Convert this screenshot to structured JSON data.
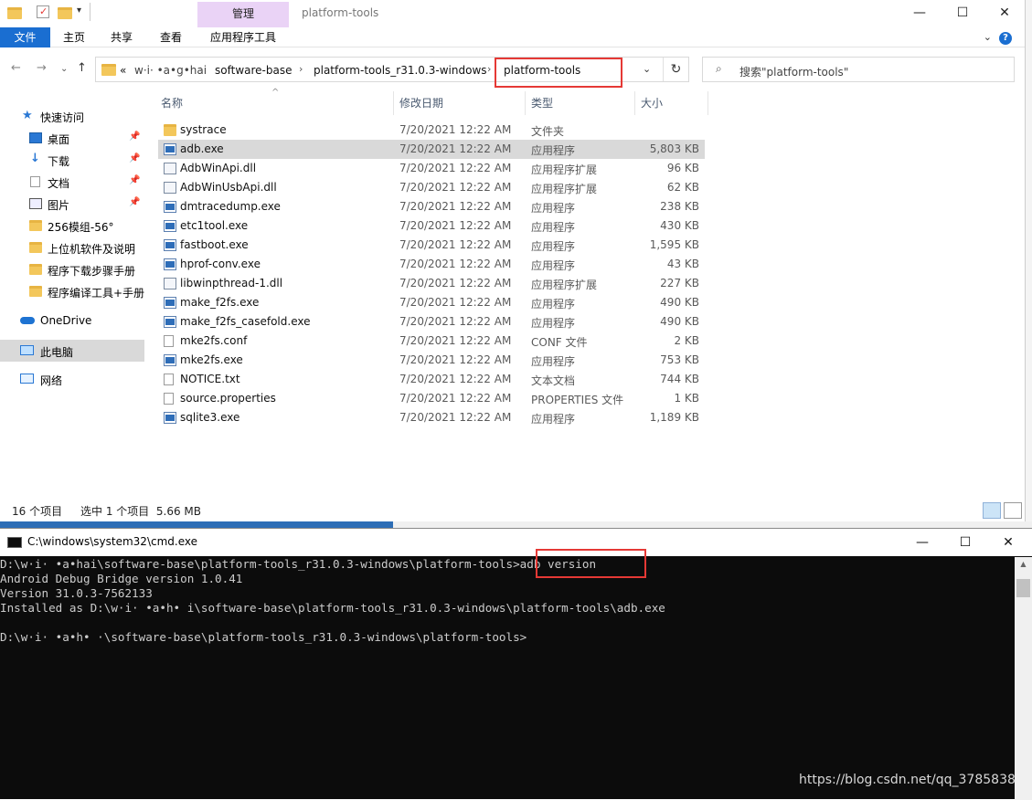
{
  "explorer": {
    "title": "platform-tools",
    "context_tab": "管理",
    "ribbon_tabs": [
      "文件",
      "主页",
      "共享",
      "查看",
      "应用程序工具"
    ],
    "window_buttons": {
      "minimize": "—",
      "maximize": "☐",
      "close": "✕"
    },
    "address_crumbs": [
      "«",
      "w·i· •a•g•hai",
      "software-base",
      "platform-tools_r31.0.3-windows",
      "platform-tools"
    ],
    "search_placeholder": "搜索\"platform-tools\"",
    "nav_pane": [
      {
        "label": "快速访问",
        "icon": "star-icon",
        "pinned": false
      },
      {
        "label": "桌面",
        "icon": "desktop-icon",
        "pinned": true
      },
      {
        "label": "下载",
        "icon": "download-icon",
        "pinned": true
      },
      {
        "label": "文档",
        "icon": "document-icon",
        "pinned": true
      },
      {
        "label": "图片",
        "icon": "picture-icon",
        "pinned": true
      },
      {
        "label": "256模组-56°",
        "icon": "folder-icon",
        "pinned": false
      },
      {
        "label": "上位机软件及说明",
        "icon": "folder-icon",
        "pinned": false
      },
      {
        "label": "程序下载步骤手册",
        "icon": "folder-icon",
        "pinned": false
      },
      {
        "label": "程序编译工具+手册",
        "icon": "folder-icon",
        "pinned": false
      },
      {
        "label": "OneDrive",
        "icon": "cloud-icon",
        "pinned": false
      },
      {
        "label": "此电脑",
        "icon": "computer-icon",
        "pinned": false
      },
      {
        "label": "网络",
        "icon": "network-icon",
        "pinned": false
      }
    ],
    "columns": {
      "name": "名称",
      "date": "修改日期",
      "type": "类型",
      "size": "大小"
    },
    "files": [
      {
        "name": "systrace",
        "date": "7/20/2021 12:22 AM",
        "type": "文件夹",
        "size": "",
        "kind": "folder"
      },
      {
        "name": "adb.exe",
        "date": "7/20/2021 12:22 AM",
        "type": "应用程序",
        "size": "5,803 KB",
        "kind": "exe"
      },
      {
        "name": "AdbWinApi.dll",
        "date": "7/20/2021 12:22 AM",
        "type": "应用程序扩展",
        "size": "96 KB",
        "kind": "dll"
      },
      {
        "name": "AdbWinUsbApi.dll",
        "date": "7/20/2021 12:22 AM",
        "type": "应用程序扩展",
        "size": "62 KB",
        "kind": "dll"
      },
      {
        "name": "dmtracedump.exe",
        "date": "7/20/2021 12:22 AM",
        "type": "应用程序",
        "size": "238 KB",
        "kind": "exe"
      },
      {
        "name": "etc1tool.exe",
        "date": "7/20/2021 12:22 AM",
        "type": "应用程序",
        "size": "430 KB",
        "kind": "exe"
      },
      {
        "name": "fastboot.exe",
        "date": "7/20/2021 12:22 AM",
        "type": "应用程序",
        "size": "1,595 KB",
        "kind": "exe"
      },
      {
        "name": "hprof-conv.exe",
        "date": "7/20/2021 12:22 AM",
        "type": "应用程序",
        "size": "43 KB",
        "kind": "exe"
      },
      {
        "name": "libwinpthread-1.dll",
        "date": "7/20/2021 12:22 AM",
        "type": "应用程序扩展",
        "size": "227 KB",
        "kind": "dll"
      },
      {
        "name": "make_f2fs.exe",
        "date": "7/20/2021 12:22 AM",
        "type": "应用程序",
        "size": "490 KB",
        "kind": "exe"
      },
      {
        "name": "make_f2fs_casefold.exe",
        "date": "7/20/2021 12:22 AM",
        "type": "应用程序",
        "size": "490 KB",
        "kind": "exe"
      },
      {
        "name": "mke2fs.conf",
        "date": "7/20/2021 12:22 AM",
        "type": "CONF 文件",
        "size": "2 KB",
        "kind": "doc"
      },
      {
        "name": "mke2fs.exe",
        "date": "7/20/2021 12:22 AM",
        "type": "应用程序",
        "size": "753 KB",
        "kind": "exe"
      },
      {
        "name": "NOTICE.txt",
        "date": "7/20/2021 12:22 AM",
        "type": "文本文档",
        "size": "744 KB",
        "kind": "doc"
      },
      {
        "name": "source.properties",
        "date": "7/20/2021 12:22 AM",
        "type": "PROPERTIES 文件",
        "size": "1 KB",
        "kind": "doc"
      },
      {
        "name": "sqlite3.exe",
        "date": "7/20/2021 12:22 AM",
        "type": "应用程序",
        "size": "1,189 KB",
        "kind": "exe"
      }
    ],
    "status": {
      "count": "16 个项目",
      "selected": "选中 1 个项目  5.66 MB"
    }
  },
  "cmd": {
    "title": "C:\\windows\\system32\\cmd.exe",
    "window_buttons": {
      "minimize": "—",
      "maximize": "☐",
      "close": "✕"
    },
    "lines": [
      "D:\\w·i· •a•hai\\software-base\\platform-tools_r31.0.3-windows\\platform-tools>adb version",
      "Android Debug Bridge version 1.0.41",
      "Version 31.0.3-7562133",
      "Installed as D:\\w·i· •a•h• i\\software-base\\platform-tools_r31.0.3-windows\\platform-tools\\adb.exe",
      "",
      "D:\\w·i· •a•h• ·\\software-base\\platform-tools_r31.0.3-windows\\platform-tools>"
    ]
  },
  "watermark": "https://blog.csdn.net/qq_3785838"
}
